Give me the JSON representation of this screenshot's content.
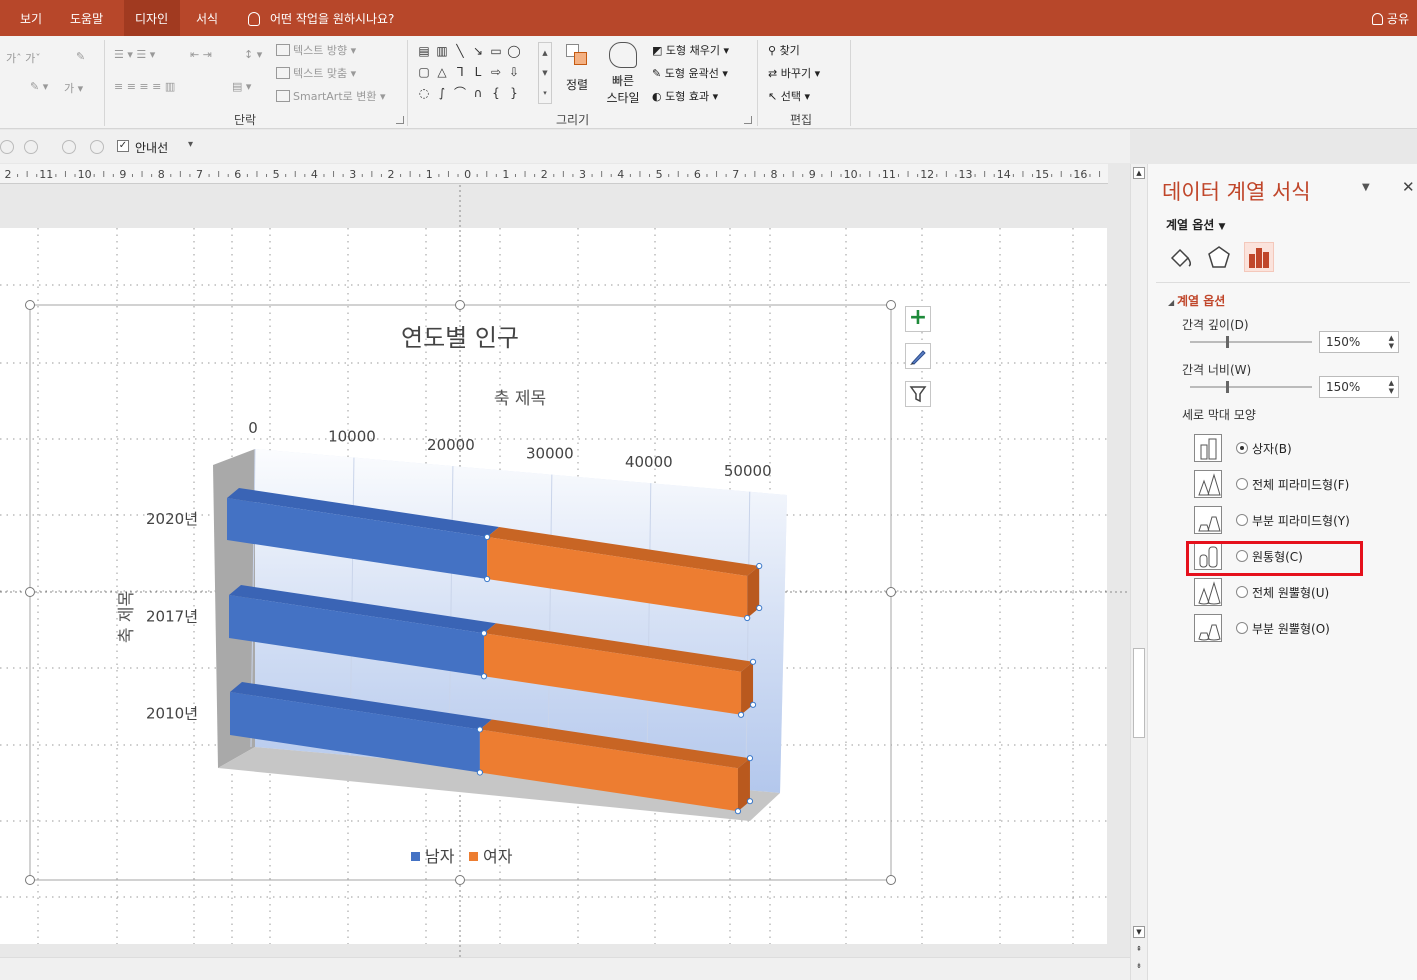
{
  "tabs": [
    "보기",
    "도움말",
    "디자인",
    "서식"
  ],
  "active_tab": "디자인",
  "tell_me": "어떤 작업을 원하시나요?",
  "share": "공유",
  "ribbon": {
    "paragraph_group": "단락",
    "drawing_group": "그리기",
    "editing_group": "편집",
    "text_direction": "텍스트 방향",
    "align_text": "텍스트 맞춤",
    "smartart": "SmartArt로 변환",
    "arrange": "정렬",
    "quick_styles_line1": "빠른",
    "quick_styles_line2": "스타일",
    "shape_fill": "도형 채우기",
    "shape_outline": "도형 윤곽선",
    "shape_effects": "도형 효과",
    "find": "찾기",
    "replace": "바꾸기",
    "select": "선택",
    "font_size_up": "가",
    "font_size_down": "가"
  },
  "quick": {
    "guides_label": "안내선",
    "guides_checked": true
  },
  "ruler_labels": [
    "2",
    "11",
    "10",
    "9",
    "8",
    "7",
    "6",
    "5",
    "4",
    "3",
    "2",
    "1",
    "0",
    "1",
    "2",
    "3",
    "4",
    "5",
    "6",
    "7",
    "8",
    "9",
    "10",
    "11",
    "12",
    "13",
    "14",
    "15",
    "16"
  ],
  "chart_data": {
    "type": "bar",
    "orientation": "horizontal",
    "stacked": true,
    "three_d": true,
    "title": "연도별 인구",
    "xlabel": "축 제목",
    "ylabel": "축 제목",
    "x_ticks": [
      "0",
      "10000",
      "20000",
      "30000",
      "40000",
      "50000"
    ],
    "xlim": [
      0,
      50000
    ],
    "categories": [
      "2020년",
      "2017년",
      "2010년"
    ],
    "series": [
      {
        "name": "남자",
        "color": "#4472c4",
        "values": [
          25500,
          25000,
          24500
        ]
      },
      {
        "name": "여자",
        "color": "#ed7d31",
        "values": [
          25500,
          25200,
          25300
        ]
      }
    ],
    "legend_position": "bottom",
    "grid": true
  },
  "pane": {
    "title": "데이터 계열 서식",
    "options_dropdown": "계열 옵션",
    "section": "계열 옵션",
    "gap_depth_label": "간격 깊이(D)",
    "gap_depth_value": "150%",
    "gap_width_label": "간격 너비(W)",
    "gap_width_value": "150%",
    "shape_label": "세로 막대 모양",
    "shapes": [
      {
        "label": "상자(B)",
        "selected": true
      },
      {
        "label": "전체 피라미드형(F)",
        "selected": false
      },
      {
        "label": "부분 피라미드형(Y)",
        "selected": false
      },
      {
        "label": "원통형(C)",
        "selected": false
      },
      {
        "label": "전체 원뿔형(U)",
        "selected": false
      },
      {
        "label": "부분 원뿔형(O)",
        "selected": false
      }
    ]
  }
}
